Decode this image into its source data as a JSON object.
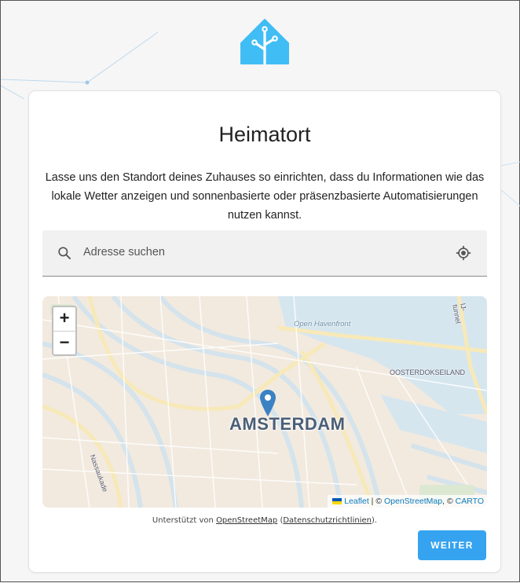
{
  "logo": {
    "icon": "home-assistant-logo-icon",
    "color": "#41bdf5"
  },
  "card": {
    "title": "Heimatort",
    "intro": "Lasse uns den Standort deines Zuhauses so einrichten, dass du Informationen wie das lokale Wetter anzeigen und sonnenbasierte oder präsenzbasierte Automatisierungen nutzen kannst.",
    "search": {
      "placeholder": "Adresse suchen",
      "search_icon": "search-icon",
      "location_icon": "my-location-icon"
    },
    "map": {
      "zoom_in": "+",
      "zoom_out": "−",
      "city_label": "AMSTERDAM",
      "labels": {
        "water": "Open Havenfront",
        "district": "OOSTERDOKSEILAND",
        "street": "Nassaukade",
        "tunnel": "IJ-tunnel"
      },
      "marker_color": "#3b82c4",
      "attribution": {
        "leaflet": "Leaflet",
        "sep1": " | © ",
        "osm": "OpenStreetMap",
        "sep2": ", © ",
        "carto": "CARTO"
      }
    },
    "footnote": {
      "prefix": "Unterstützt von ",
      "osm_link": "OpenStreetMap",
      "middle": " (",
      "privacy_link": "Datenschutzrichtlinien",
      "suffix": ")."
    },
    "next_button": "WEITER",
    "accent": "#35a3ef"
  }
}
